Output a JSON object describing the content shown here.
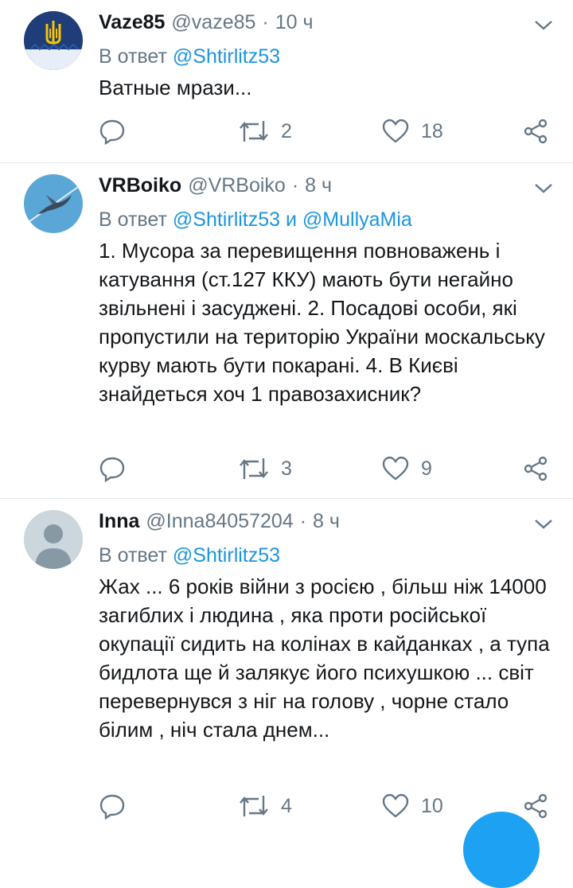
{
  "tweets": [
    {
      "avatar": "ukraine-trident-avatar",
      "name": "Vaze85",
      "handle": "@vaze85",
      "dot": "·",
      "time": "10 ч",
      "reply_prefix": "В ответ",
      "reply_to": "@Shtirlitz53",
      "text": "Ватные мрази...",
      "retweets": "2",
      "likes": "18"
    },
    {
      "avatar": "bird-flying-avatar",
      "name": "VRBoiko",
      "handle": "@VRBoiko",
      "dot": "·",
      "time": "8 ч",
      "reply_prefix": "В ответ",
      "reply_to": "@Shtirlitz53 и @MullyaMia",
      "text": "1. Мусора за перевищення повноважень і катування (ст.127 ККУ) мають бути негайно звільнені і засуджені. 2. Посадові особи, які  пропустили на територію України москальську курву мають бути покарані. 4. В Києві знайдеться хоч 1 правозахисник?",
      "retweets": "3",
      "likes": "9"
    },
    {
      "avatar": "default-user-avatar",
      "name": "Inna",
      "handle": "@Inna84057204",
      "dot": "·",
      "time": "8 ч",
      "reply_prefix": "В ответ",
      "reply_to": "@Shtirlitz53",
      "text": "Жах ... 6 років війни з росією , більш ніж 14000 загиблих і людина , яка проти російської  окупації сидить на колінах в кайданках , а тупа  бидлота ще й  залякує його психушкою ... світ перевернувся з ніг на голову , чорне стало білим , ніч стала днем...",
      "retweets": "4",
      "likes": "10"
    }
  ],
  "colors": {
    "accent": "#1b95e0",
    "muted": "#657786",
    "text": "#14171a",
    "divider": "#e1e8ed",
    "fab": "#1da1f2"
  }
}
